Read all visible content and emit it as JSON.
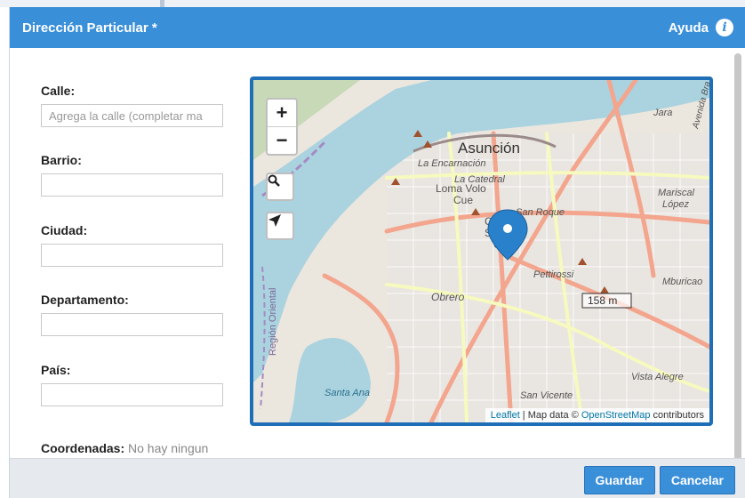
{
  "dialog": {
    "title": "Dirección Particular *",
    "help_label": "Ayuda",
    "help_icon": "info-circle-icon"
  },
  "form": {
    "street_label": "Calle:",
    "street_placeholder": "Agrega la calle (completar ma",
    "street_value": "",
    "neighborhood_label": "Barrio:",
    "neighborhood_value": "",
    "city_label": "Ciudad:",
    "city_value": "",
    "department_label": "Departamento:",
    "department_value": "",
    "country_label": "País:",
    "country_value": "",
    "coords_label": "Coordenadas:",
    "coords_text": "No hay ningun"
  },
  "map": {
    "zoom_in": "+",
    "zoom_out": "−",
    "search_icon": "search-icon",
    "locate_icon": "locate-arrow-icon",
    "marker_icon": "map-marker-icon",
    "labels": {
      "city": "Asunción",
      "encarnacion": "La Encarnación",
      "catedral": "La Catedral",
      "loma_volo": "Loma Volo",
      "cue": "Cue",
      "san_roque": "San Roque",
      "ce": "Ce",
      "sa": "Sa",
      "cu": "Cu",
      "pettirossi": "Pettirossi",
      "obrero": "Obrero",
      "mburicao": "Mburicao",
      "scale": "158 m",
      "region": "Región Oriental",
      "santa_ana": "Santa Ana",
      "san_vicente": "San Vicente",
      "vista_alegre": "Vista Alegre",
      "jara": "Jara",
      "mariscal": "Mariscal",
      "lopez": "López",
      "avenida": "Avenida Bra"
    },
    "attribution": {
      "leaflet": "Leaflet",
      "sep": " | Map data © ",
      "osm": "OpenStreetMap",
      "suffix": " contributors"
    },
    "colors": {
      "river": "#aad3df",
      "land": "#e8e4dc",
      "main_road": "#f3a58d",
      "secondary_road": "#f7fabf",
      "border": "#1f6fb8"
    }
  },
  "footer": {
    "save_label": "Guardar",
    "cancel_label": "Cancelar"
  },
  "colors": {
    "header": "#3a8fd9",
    "button": "#3a8fd9"
  }
}
